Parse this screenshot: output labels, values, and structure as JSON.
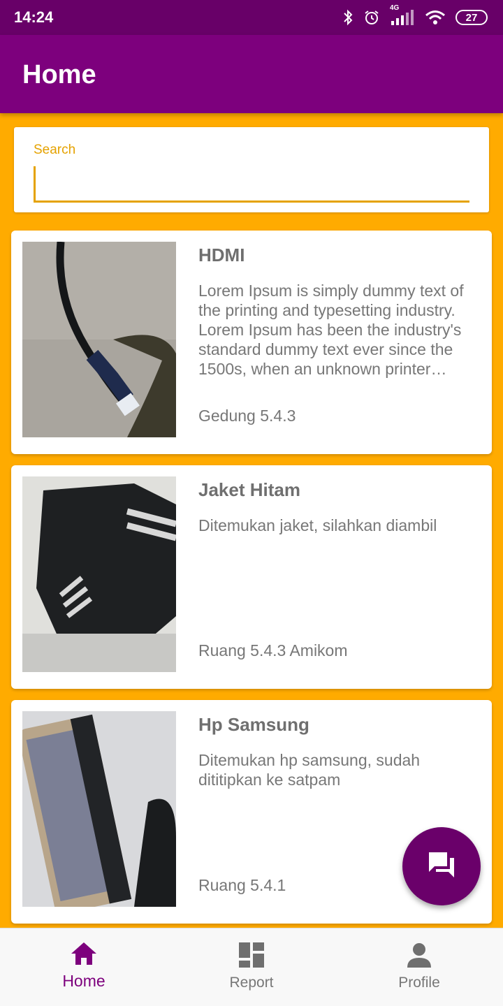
{
  "status_bar": {
    "time": "14:24",
    "network": "4G",
    "battery": "27",
    "icons": [
      "bluetooth-icon",
      "alarm-icon",
      "signal-icon",
      "wifi-icon",
      "battery-icon"
    ]
  },
  "app_bar": {
    "title": "Home"
  },
  "search": {
    "label": "Search",
    "value": ""
  },
  "items": [
    {
      "title": "HDMI",
      "description": "Lorem Ipsum is simply dummy text of the printing and typesetting industry. Lorem Ipsum has been the industry's standard dummy text ever since the 1500s, when an unknown printer took a galley of type and scrambled it to make a type specimen book.",
      "location": "Gedung 5.4.3"
    },
    {
      "title": "Jaket Hitam",
      "description": "Ditemukan jaket, silahkan diambil",
      "location": "Ruang 5.4.3 Amikom"
    },
    {
      "title": "Hp Samsung",
      "description": "Ditemukan hp samsung, sudah dititipkan ke satpam",
      "location": "Ruang 5.4.1"
    }
  ],
  "fab": {
    "icon": "chat-icon"
  },
  "bottom_nav": {
    "items": [
      {
        "label": "Home",
        "icon": "home-icon",
        "active": true
      },
      {
        "label": "Report",
        "icon": "dashboard-icon",
        "active": false
      },
      {
        "label": "Profile",
        "icon": "person-icon",
        "active": false
      }
    ]
  },
  "colors": {
    "status_bar": "#680068",
    "app_bar": "#7d007d",
    "background": "#ffab00",
    "search_accent": "#e5a200",
    "fab": "#6a006a"
  }
}
